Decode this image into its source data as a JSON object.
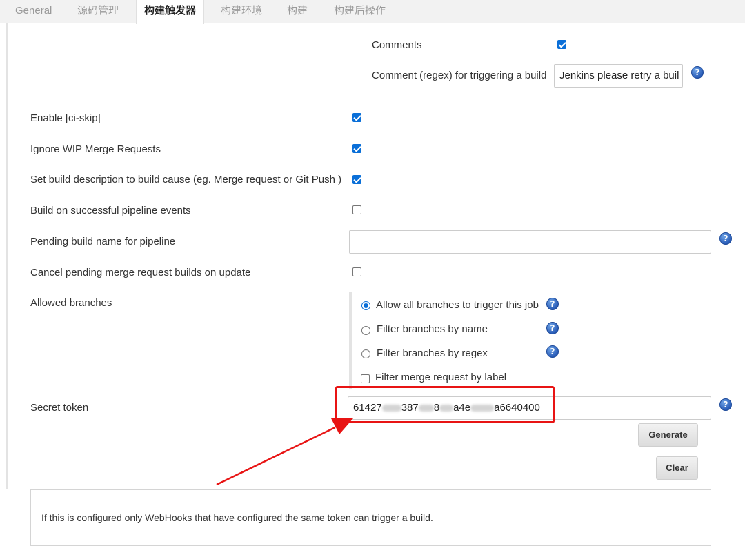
{
  "tabs": [
    "General",
    "源码管理",
    "构建触发器",
    "构建环境",
    "构建",
    "构建后操作"
  ],
  "active_tab": "构建触发器",
  "comments": {
    "label": "Comments",
    "checked": true
  },
  "comment_regex": {
    "label": "Comment (regex) for triggering a build",
    "value": "Jenkins please retry a buil"
  },
  "options": [
    {
      "label": "Enable [ci-skip]",
      "checked": true
    },
    {
      "label": "Ignore WIP Merge Requests",
      "checked": true
    },
    {
      "label": "Set build description to build cause (eg. Merge request or Git Push )",
      "checked": true
    },
    {
      "label": "Build on successful pipeline events",
      "checked": false
    },
    {
      "label": "Pending build name for pipeline",
      "value": ""
    },
    {
      "label": "Cancel pending merge request builds on update",
      "checked": false
    }
  ],
  "allowed_branches": {
    "label": "Allowed branches",
    "choices": [
      {
        "label": "Allow all branches to trigger this job",
        "selected": true
      },
      {
        "label": "Filter branches by name",
        "selected": false
      },
      {
        "label": "Filter branches by regex",
        "selected": false
      }
    ],
    "label_filter": {
      "label": "Filter merge request by label",
      "checked": false
    }
  },
  "secret_token": {
    "label": "Secret token",
    "value_visible_parts": [
      "61427",
      "387",
      "8",
      "a4e",
      "a6640400"
    ],
    "value_obscured": true
  },
  "buttons": {
    "generate": "Generate",
    "clear": "Clear"
  },
  "help_text": "If this is configured only WebHooks that have configured the same token can trigger a build.",
  "colors": {
    "accent": "#0a6fd8",
    "highlight": "#e81414",
    "help_icon": "#2a5db8"
  }
}
